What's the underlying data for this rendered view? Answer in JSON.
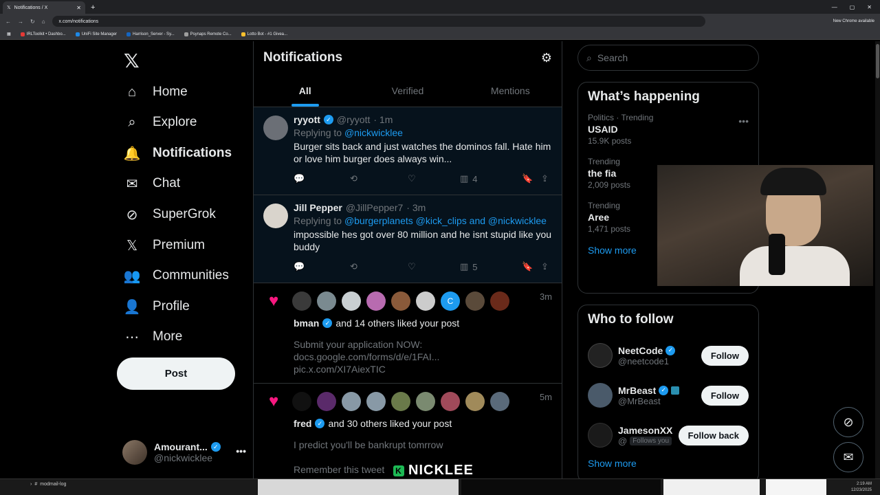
{
  "browser": {
    "tab_title": "Notifications / X",
    "url": "x.com/notifications",
    "update_notice": "New Chrome available",
    "bookmarks": [
      "IRLToolkit • Dashbo...",
      "UniFi Site Manager",
      "Harrison_Server - Sy...",
      "Psynaps Remote Co...",
      "Lotto Bot - #1 Givea..."
    ]
  },
  "nav": {
    "items": [
      {
        "label": "Home",
        "icon": "⌂"
      },
      {
        "label": "Explore",
        "icon": "⌕"
      },
      {
        "label": "Notifications",
        "icon": "🔔"
      },
      {
        "label": "Chat",
        "icon": "✉"
      },
      {
        "label": "SuperGrok",
        "icon": "⊘"
      },
      {
        "label": "Premium",
        "icon": "𝕏"
      },
      {
        "label": "Communities",
        "icon": "👥"
      },
      {
        "label": "Profile",
        "icon": "👤"
      },
      {
        "label": "More",
        "icon": "⋯"
      }
    ],
    "post_label": "Post",
    "account": {
      "name": "Amourant...",
      "handle": "@nickwicklee"
    }
  },
  "main": {
    "title": "Notifications",
    "tabs": [
      "All",
      "Verified",
      "Mentions"
    ],
    "replies": [
      {
        "name": "ryyott",
        "handle": "@ryyott",
        "time": "· 1m",
        "replying_prefix": "Replying to",
        "replying_to": "@nickwicklee",
        "text": "Burger sits back and just watches the dominos fall. Hate him or love him burger does always win...",
        "views": "4",
        "avatar_color": "#6b6f76"
      },
      {
        "name": "Jill Pepper",
        "handle": "@JillPepper7",
        "time": "· 3m",
        "replying_prefix": "Replying to",
        "replying_to": "@burgerplanets @kick_clips and @nickwicklee",
        "text": "impossible hes got over 80 million and he isnt stupid like you buddy",
        "views": "5",
        "avatar_color": "#d9d4cc"
      }
    ],
    "likes": [
      {
        "time": "3m",
        "name": "bman",
        "rest": "and 14 others liked your post",
        "excerpt": [
          "Submit your application NOW:",
          "docs.google.com/forms/d/e/1FAI...",
          "pic.x.com/XI7AiexTIC"
        ],
        "faces": [
          "#3a3a3a",
          "#7a8a90",
          "#c9cfd2",
          "#b86bb0",
          "#8a5a3a",
          "#cccccc",
          "#1d9bf0",
          "#5a4a3a",
          "#6a2a1a"
        ]
      },
      {
        "time": "5m",
        "name": "fred",
        "rest": "and 30 others liked your post",
        "excerpt": [
          "I predict you'll be bankrupt tomrrow",
          "",
          "Remember this tweet"
        ],
        "faces": [
          "#111111",
          "#5a2a6a",
          "#8899a6",
          "#8899a6",
          "#6a7a4a",
          "#7a8a70",
          "#a04a5a",
          "#a08a5a",
          "#5a6a7a"
        ]
      }
    ],
    "caption": "NICKLEE"
  },
  "sidebar": {
    "search_placeholder": "Search",
    "happening_title": "What’s happening",
    "trends": [
      {
        "context": "Politics · Trending",
        "title": "USAID",
        "count": "15.9K posts"
      },
      {
        "context": "Trending",
        "title": "the fia",
        "count": "2,009 posts"
      },
      {
        "context": "Trending",
        "title": "Aree",
        "count": "1,471 posts"
      }
    ],
    "show_more": "Show more",
    "wtf_title": "Who to follow",
    "follow": [
      {
        "name": "NeetCode",
        "handle": "@neetcode1",
        "button": "Follow",
        "follows_you": "",
        "color": "#222222"
      },
      {
        "name": "MrBeast",
        "handle": "@MrBeast",
        "button": "Follow",
        "follows_you": "",
        "color": "#4a5a6a"
      },
      {
        "name": "JamesonXX",
        "handle": "@",
        "button": "Follow back",
        "follows_you": "Follows you",
        "color": "#1a1a1a"
      }
    ]
  },
  "taskbar": {
    "item": "modmail-log",
    "time": "2:19 AM",
    "date": "12/23/2025"
  }
}
